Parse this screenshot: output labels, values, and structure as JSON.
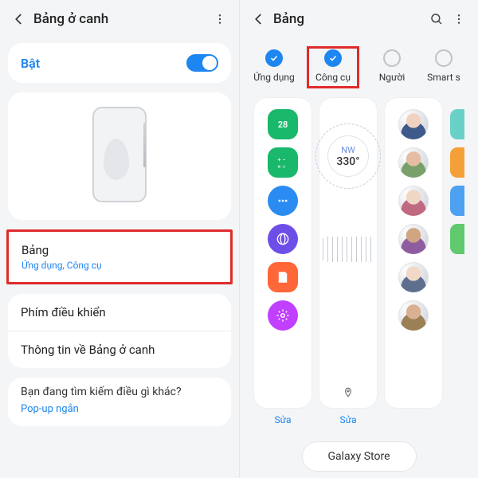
{
  "left": {
    "header_title": "Bảng ở canh",
    "toggle_label": "Bật",
    "menu": {
      "bang": {
        "title": "Bảng",
        "sub": "Ứng dụng, Công cụ"
      },
      "phim": {
        "title": "Phím điều khiển"
      },
      "info": {
        "title": "Thông tin về Bảng ở canh"
      }
    },
    "footer": {
      "q": "Bạn đang tìm kiếm điều gì khác?",
      "link": "Pop-up ngắn"
    }
  },
  "right": {
    "header_title": "Bảng",
    "tabs": {
      "apps": "Ứng dụng",
      "tools": "Công cụ",
      "people": "Người",
      "smart": "Smart s"
    },
    "compass": {
      "dir": "NW",
      "deg": "330°"
    },
    "edit_label": "Sửa",
    "store_button": "Galaxy Store",
    "cal_day": "28"
  }
}
